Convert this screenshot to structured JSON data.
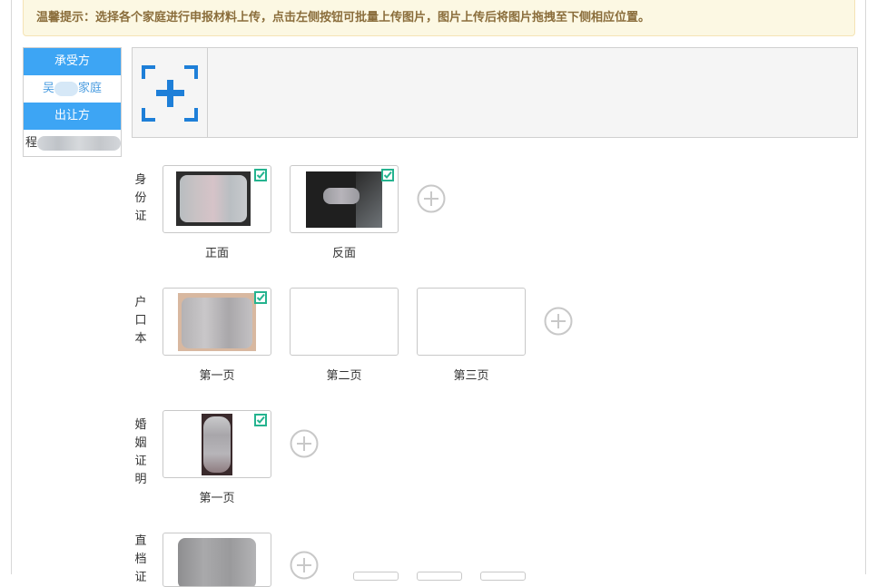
{
  "tip": "温馨提示：选择各个家庭进行申报材料上传，点击左侧按钮可批量上传图片，图片上传后将图片拖拽至下侧相应位置。",
  "sidebar": {
    "receiver_header": "承受方",
    "receiver_prefix": "吴",
    "receiver_suffix": "家庭",
    "giver_header": "出让方",
    "giver_prefix": "程"
  },
  "sections": {
    "id_card": {
      "label": [
        "身",
        "份",
        "证"
      ],
      "slots": [
        "正面",
        "反面"
      ]
    },
    "household": {
      "label": [
        "户",
        "口",
        "本"
      ],
      "slots": [
        "第一页",
        "第二页",
        "第三页"
      ]
    },
    "marriage": {
      "label": [
        "婚",
        "姻",
        "证",
        "明"
      ],
      "slots": [
        "第一页"
      ]
    },
    "direct": {
      "label": [
        "直",
        "档",
        "证"
      ]
    }
  },
  "colors": {
    "accent": "#3da5f4",
    "upload_blue": "#1e7fd8",
    "check_green": "#25b38f"
  },
  "icons": {
    "upload": "plus-bracket-icon",
    "add": "plus-circle-icon",
    "check": "check-icon"
  }
}
